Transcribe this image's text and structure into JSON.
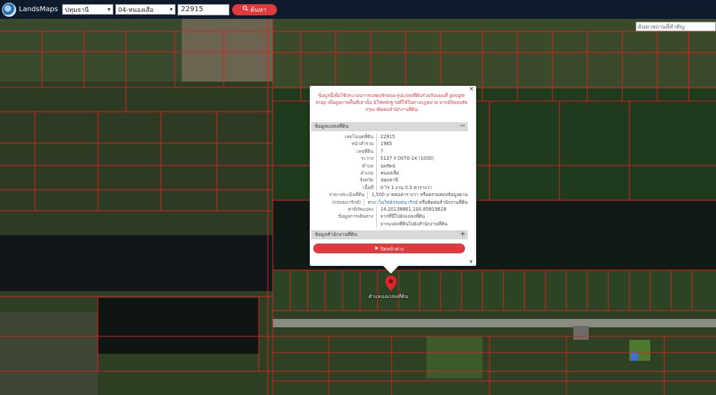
{
  "header": {
    "brand": "LandsMaps",
    "province": "ปทุมธานี",
    "district": "04-หนองเสือ",
    "parcel_no": "22915",
    "search_label": "ค้นหา"
  },
  "map": {
    "place_search_placeholder": "ค้นหาสถานที่สำคัญ",
    "marker_label": "ตำแหน่งแปลงที่ดิน"
  },
  "popup": {
    "notice": "ข้อมูลนี้เพื่อใช้ประกอบการแสดงลักษณะรูปแปลงที่ดินร่วมกับแผนที่ google map เพื่อดูสภาพพื้นที่เท่านั้น มิใช่หลักฐานที่ใช้ในทางกฎหมาย หากมีข้อสงสัย กรุณาติดต่อสำนักงานที่ดิน",
    "section_parcel": "ข้อมูลแปลงที่ดิน",
    "section_office": "ข้อมูลสำนักงานที่ดิน",
    "rows": [
      {
        "label": "เลขโฉนดที่ดิน",
        "value": "22915"
      },
      {
        "label": "หน้าสำรวจ",
        "value": "1965"
      },
      {
        "label": "เลขที่ดิน",
        "value": "7"
      },
      {
        "label": "ระวาง",
        "value": "5137 II 0070-14 (1000)"
      },
      {
        "label": "ตำบล",
        "value": "นพรัตน์"
      },
      {
        "label": "อำเภอ",
        "value": "หนองเสือ"
      },
      {
        "label": "จังหวัด",
        "value": "ปทุมธานี"
      },
      {
        "label": "เนื้อที่",
        "value": "0 ไร่ 1 งาน 0.0 ตารางวา"
      },
      {
        "label": "ราคาประเมินที่ดิน",
        "value": "1,500 บาทต่อตารางวา หรือตรวจสอบข้อมูลผ่าน"
      },
      {
        "label": "(กรมธนารักษ์)",
        "value_prefix": "ทาง",
        "value_link": "เว็บไซต์กรมธนารักษ์",
        "value_suffix": "หรือติดต่อสำนักงานที่ดิน"
      },
      {
        "label": "ค่าพิกัดแปลง",
        "value": "14.20138861,100.85819828"
      },
      {
        "label": "ข้อมูลการเดินทาง",
        "value": "จากที่นี่ไปยังแปลงที่ดิน"
      },
      {
        "label": "",
        "value": "จากแปลงที่ดินไปยังสำนักงานที่ดิน"
      }
    ],
    "close_label": "ปิดหน้าต่าง",
    "close_x": "×",
    "toggle_minus": "−",
    "toggle_plus": "+"
  },
  "colors": {
    "accent": "#e03a3e",
    "topbar": "#0e1b2c",
    "parcel_line": "#e02020",
    "link": "#2a6bd1"
  }
}
